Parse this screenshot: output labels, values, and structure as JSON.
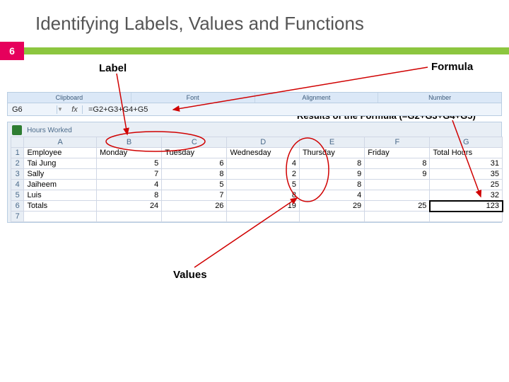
{
  "slide": {
    "title": "Identifying Labels, Values and Functions",
    "number": "6"
  },
  "annotations": {
    "label": "Label",
    "formula": "Formula",
    "results": "Results of the Formula (=G2+G3+G4+G5)",
    "values": "Values"
  },
  "excel": {
    "ribbon_groups": [
      "Clipboard",
      "Font",
      "Alignment",
      "Number"
    ],
    "name_box": "G6",
    "fx_symbol": "fx",
    "formula_bar": "=G2+G3+G4+G5",
    "workbook_title": "Hours Worked",
    "columns": [
      "A",
      "B",
      "C",
      "D",
      "E",
      "F",
      "G"
    ],
    "rows": [
      {
        "n": "1",
        "cells": [
          "Employee",
          "Monday",
          "Tuesday",
          "Wednesday",
          "Thursday",
          "Friday",
          "Total Hours"
        ]
      },
      {
        "n": "2",
        "cells": [
          "Tai Jung",
          "5",
          "6",
          "4",
          "8",
          "8",
          "31"
        ]
      },
      {
        "n": "3",
        "cells": [
          "Sally",
          "7",
          "8",
          "2",
          "9",
          "9",
          "35"
        ]
      },
      {
        "n": "4",
        "cells": [
          "Jaiheem",
          "4",
          "5",
          "5",
          "8",
          "",
          "25"
        ]
      },
      {
        "n": "5",
        "cells": [
          "Luis",
          "8",
          "7",
          "8",
          "4",
          "",
          "32"
        ]
      },
      {
        "n": "6",
        "cells": [
          "Totals",
          "24",
          "26",
          "19",
          "29",
          "25",
          "123"
        ]
      },
      {
        "n": "7",
        "cells": [
          "",
          "",
          "",
          "",
          "",
          "",
          ""
        ]
      }
    ]
  },
  "chart_data": {
    "type": "table",
    "title": "Hours Worked",
    "columns": [
      "Employee",
      "Monday",
      "Tuesday",
      "Wednesday",
      "Thursday",
      "Friday",
      "Total Hours"
    ],
    "rows": [
      [
        "Tai Jung",
        5,
        6,
        4,
        8,
        8,
        31
      ],
      [
        "Sally",
        7,
        8,
        2,
        9,
        9,
        35
      ],
      [
        "Jaiheem",
        4,
        5,
        5,
        8,
        null,
        25
      ],
      [
        "Luis",
        8,
        7,
        8,
        4,
        null,
        32
      ],
      [
        "Totals",
        24,
        26,
        19,
        29,
        25,
        123
      ]
    ],
    "formula_cell": {
      "ref": "G6",
      "formula": "=G2+G3+G4+G5",
      "value": 123
    }
  }
}
